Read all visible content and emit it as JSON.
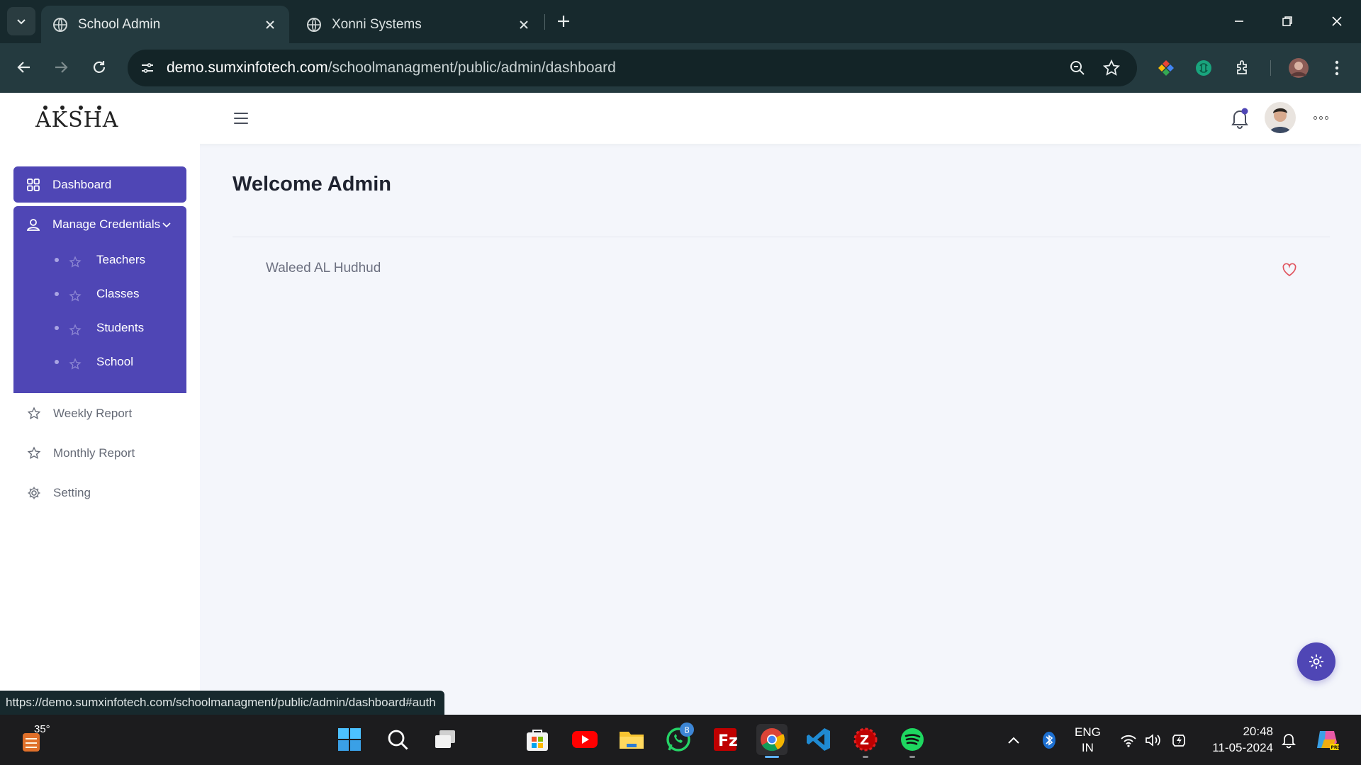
{
  "browser": {
    "tabs": [
      {
        "title": "School Admin",
        "active": true
      },
      {
        "title": "Xonni Systems",
        "active": false
      }
    ],
    "address": {
      "host": "demo.sumxinfotech.com",
      "path": "/schoolmanagment/public/admin/dashboard"
    },
    "status_url": "https://demo.sumxinfotech.com/schoolmanagment/public/admin/dashboard#auth"
  },
  "header": {
    "logo_text": "AKSHAR",
    "notification_dot": true
  },
  "sidebar": {
    "dashboard_label": "Dashboard",
    "group_label": "Manage Credentials",
    "group_items": [
      {
        "label": "Teachers"
      },
      {
        "label": "Classes"
      },
      {
        "label": "Students"
      },
      {
        "label": "School"
      }
    ],
    "links": [
      {
        "label": "Weekly Report",
        "icon": "star-icon"
      },
      {
        "label": "Monthly Report",
        "icon": "star-icon"
      },
      {
        "label": "Setting",
        "icon": "gear-icon"
      }
    ]
  },
  "main": {
    "title": "Welcome Admin",
    "user_name": "Waleed AL Hudhud"
  },
  "taskbar": {
    "temperature": "35°",
    "whatsapp_badge": "8",
    "lang_line1": "ENG",
    "lang_line2": "IN",
    "time": "20:48",
    "date": "11-05-2024"
  },
  "colors": {
    "accent": "#4f46b5",
    "chrome_dark": "#17292d",
    "chrome_toolbar": "#243a3f",
    "heart": "#e0555f"
  }
}
